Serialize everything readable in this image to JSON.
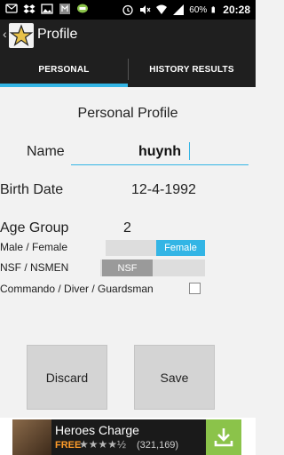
{
  "status_bar": {
    "battery": "60%",
    "time": "20:28"
  },
  "app": {
    "title": "Profile",
    "back_icon": "chevron-left-icon",
    "app_icon": "star-icon"
  },
  "tabs": [
    {
      "label": "PERSONAL",
      "active": true
    },
    {
      "label": "HISTORY RESULTS",
      "active": false
    }
  ],
  "form": {
    "section_title": "Personal Profile",
    "name_label": "Name",
    "name_value": "huynh",
    "birth_date_label": "Birth Date",
    "birth_date_value": "12-4-1992",
    "age_group_label": "Age Group",
    "age_group_value": "2",
    "sex_label": "Male / Female",
    "sex_value": "Female",
    "nsf_label": "NSF / NSMEN",
    "nsf_value": "NSF",
    "commando_label": "Commando / Diver / Guardsman",
    "commando_checked": false
  },
  "buttons": {
    "discard": "Discard",
    "save": "Save"
  },
  "ad": {
    "title": "Heroes Charge",
    "price": "FREE",
    "stars": "★★★★½",
    "rating_count": "(321,169)",
    "accent": "#8bc34a"
  },
  "colors": {
    "accent": "#33b5e5",
    "bar_bg": "#1f1f1f"
  }
}
